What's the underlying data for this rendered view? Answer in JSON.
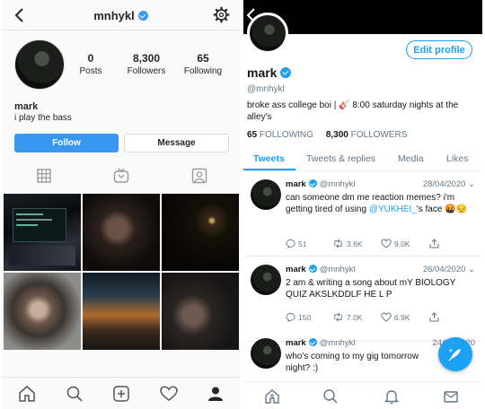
{
  "instagram": {
    "username": "mnhykl",
    "stats": [
      {
        "num": "0",
        "label": "Posts"
      },
      {
        "num": "8,300",
        "label": "Followers"
      },
      {
        "num": "65",
        "label": "Following"
      }
    ],
    "name": "mark",
    "bio": "i play the bass",
    "follow_label": "Follow",
    "message_label": "Message",
    "tabs": [
      "grid-icon",
      "igtv-icon",
      "tagged-icon"
    ],
    "bottom_nav": [
      "home-icon",
      "search-icon",
      "add-post-icon",
      "heart-icon",
      "profile-icon"
    ],
    "accent": "#3897f0"
  },
  "twitter": {
    "edit_profile": "Edit profile",
    "name": "mark",
    "handle": "@mnhykl",
    "bio": "broke ass college boi | 🎸 8:00 saturday nights at the alley's",
    "following_num": "65",
    "following_label": "FOLLOWING",
    "followers_num": "8,300",
    "followers_label": "FOLLOWERS",
    "tabs": [
      "Tweets",
      "Tweets & replies",
      "Media",
      "Likes"
    ],
    "accent": "#1da1f2",
    "tweets": [
      {
        "name": "mark",
        "handle": "@mnhykl",
        "date": "28/04/2020",
        "text_before": "can someone dm me reaction memes? i'm getting tired of using ",
        "mention": "@YUKHEI_",
        "text_after": "'s face 🤬😔",
        "replies": "51",
        "retweets": "3.6K",
        "likes": "9.0K"
      },
      {
        "name": "mark",
        "handle": "@mnhykl",
        "date": "26/04/2020",
        "text_before": "2 am & writing a song about mY BIOLOGY QUIZ AKSLKDDLF HE L P",
        "mention": "",
        "text_after": "",
        "replies": "150",
        "retweets": "7.0K",
        "likes": "6.9K"
      },
      {
        "name": "mark",
        "handle": "@mnhykl",
        "date": "24/04/2020",
        "text_before": "who's coming to my gig tomorrow night? :)",
        "mention": "",
        "text_after": "",
        "replies": "",
        "retweets": "",
        "likes": ""
      }
    ],
    "bottom_nav": [
      "home-icon",
      "search-icon",
      "notifications-icon",
      "messages-icon"
    ]
  }
}
